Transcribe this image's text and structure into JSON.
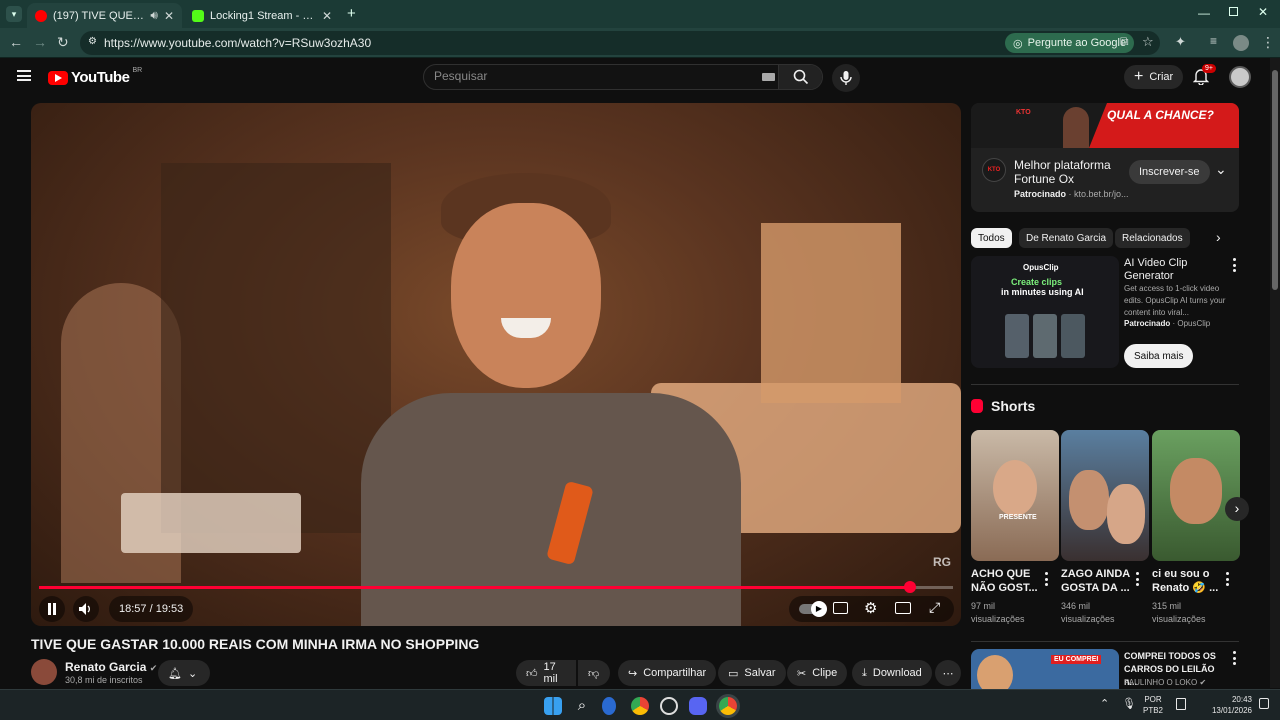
{
  "browser": {
    "tabs": [
      {
        "title": "(197) TIVE QUE GASTAR 10.000",
        "active": true
      },
      {
        "title": "Locking1 Stream - Watch Live o",
        "active": false
      }
    ],
    "new_tab": "+",
    "url": "https://www.youtube.com/watch?v=RSuw3ozhA30",
    "google_ask": "Pergunte ao Google"
  },
  "youtube": {
    "logo": "YouTube",
    "country": "BR",
    "search_placeholder": "Pesquisar",
    "create_label": "Criar",
    "notif_badge": "9+"
  },
  "player": {
    "time": "18:57 / 19:53",
    "progress": 0.953,
    "watermark": "RG"
  },
  "video": {
    "title": "TIVE QUE GASTAR 10.000 REAIS COM MINHA IRMA NO SHOPPING",
    "channel": "Renato Garcia",
    "subscribers": "30,8 mi de inscritos",
    "likes": "17 mil",
    "share": "Compartilhar",
    "save": "Salvar",
    "clip": "Clipe",
    "download": "Download"
  },
  "ad": {
    "banner_brand": "KTO",
    "banner_text": "QUAL A CHANCE?",
    "logo": "KTO",
    "title": "Melhor plataforma Fortune Ox",
    "sponsored": "Patrocinado",
    "domain": "kto.bet.br/jo...",
    "subscribe": "Inscrever-se"
  },
  "chips": [
    "Todos",
    "De Renato Garcia",
    "Relacionados"
  ],
  "opus": {
    "brand": "OpusClip",
    "headline1": "Create clips",
    "headline2": "in minutes using AI",
    "title": "AI Video Clip Generator",
    "desc": "Get access to 1-click video edits. OpusClip AI turns your content into viral...",
    "sponsored": "Patrocinado",
    "advertiser": "OpusClip",
    "cta": "Saiba mais"
  },
  "shorts": {
    "heading": "Shorts",
    "items": [
      {
        "title": "ACHO QUE NÃO GOST...",
        "views": "97 mil visualizações",
        "overlay": "PRESENTE"
      },
      {
        "title": "ZAGO AINDA GOSTA DA ...",
        "views": "346 mil visualizações"
      },
      {
        "title": "ci eu sou o Renato 🤣 ...",
        "views": "315 mil visualizações"
      }
    ]
  },
  "rec": {
    "title": "COMPREI TODOS OS CARROS DO LEILÃO n...",
    "channel": "PAULINHO O LOKO",
    "thumb_text": "EU COMPREI"
  },
  "taskbar": {
    "lang1": "POR",
    "lang2": "PTB2",
    "time": "20:43",
    "date": "13/01/2026"
  }
}
